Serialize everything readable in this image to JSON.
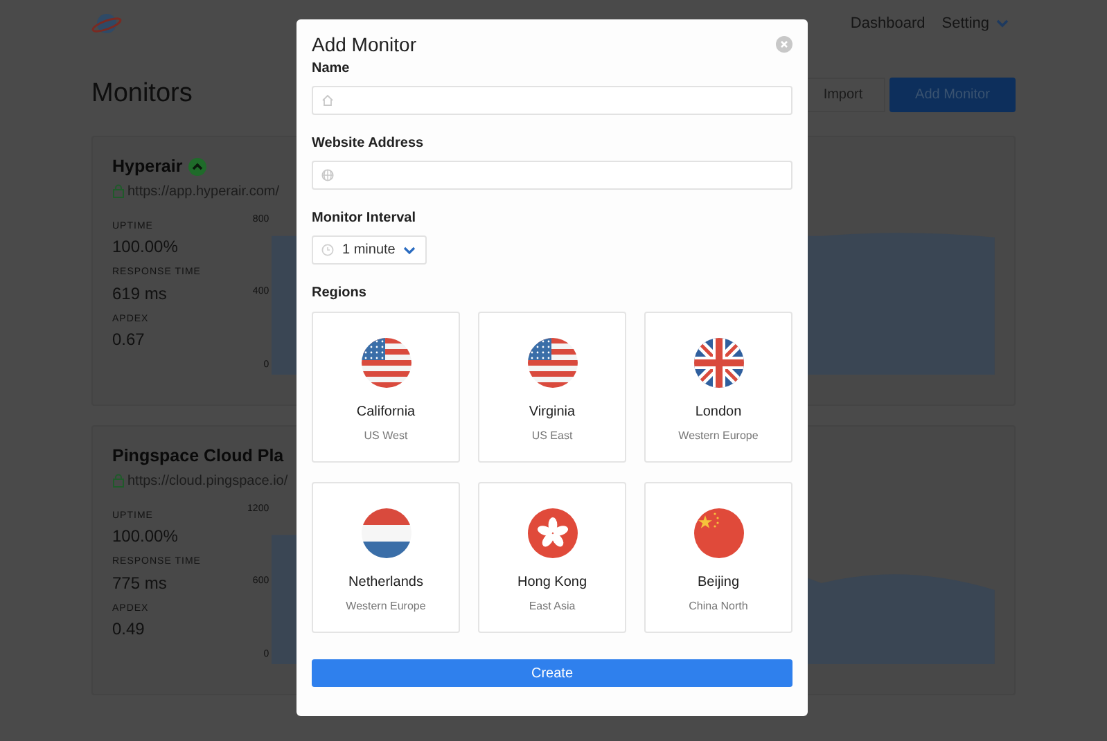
{
  "nav": {
    "links": [
      "Dashboard",
      "Setting"
    ]
  },
  "page": {
    "title": "Monitors",
    "buttons": [
      "Import",
      "Add Monitor"
    ]
  },
  "monitors": [
    {
      "name": "Hyperair",
      "status_up": true,
      "url": "https://app.hyperair.com/",
      "stats": [
        {
          "label": "UPTIME",
          "value": "100.00%"
        },
        {
          "label": "RESPONSE TIME",
          "value": "619 ms"
        },
        {
          "label": "APDEX",
          "value": "0.67"
        }
      ],
      "y_axis_labels": [
        "800",
        "400",
        "0"
      ]
    },
    {
      "name": "Pingspace Cloud Pla",
      "url": "https://cloud.pingspace.io/",
      "stats": [
        {
          "label": "UPTIME",
          "value": "100.00%"
        },
        {
          "label": "RESPONSE TIME",
          "value": "775 ms"
        },
        {
          "label": "APDEX",
          "value": "0.49"
        }
      ],
      "y_axis_labels": [
        "1200",
        "600",
        "0"
      ]
    }
  ],
  "modal": {
    "title": "Add Monitor",
    "fields": [
      {
        "label": "Name",
        "kind": "home"
      },
      {
        "label": "Website Address",
        "kind": "globe"
      }
    ],
    "interval": {
      "label": "Monitor Interval",
      "value": "1 minute"
    },
    "regions_label": "Regions",
    "regions": [
      {
        "name": "California",
        "area": "US West",
        "kind": "us"
      },
      {
        "name": "Virginia",
        "area": "US East",
        "kind": "us"
      },
      {
        "name": "London",
        "area": "Western Europe",
        "kind": "uk"
      },
      {
        "name": "Netherlands",
        "area": "Western Europe",
        "kind": "nl"
      },
      {
        "name": "Hong Kong",
        "area": "East Asia",
        "kind": "hk"
      },
      {
        "name": "Beijing",
        "area": "China North",
        "kind": "cn"
      }
    ],
    "submit": "Create"
  }
}
